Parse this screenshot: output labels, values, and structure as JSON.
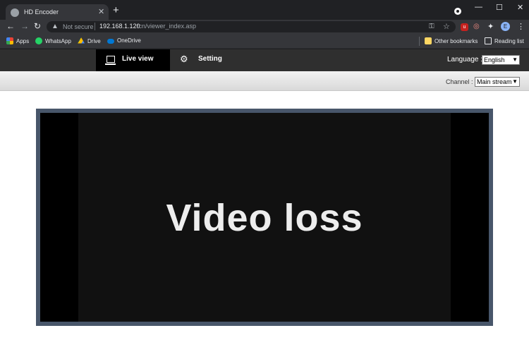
{
  "browser": {
    "tab_title": "HD Encoder",
    "tab_close": "✕",
    "new_tab": "+",
    "window_controls": {
      "minimize": "—",
      "maximize": "☐",
      "close": "✕"
    },
    "nav": {
      "back": "←",
      "forward": "→",
      "reload": "↻"
    },
    "security_label": "Not secure",
    "url_host": "192.168.1.120",
    "url_path": "/cn/viewer_index.asp",
    "avatar_initial": "E",
    "ublock_badge": "u",
    "menu": "⋮"
  },
  "bookmarks": {
    "items": [
      {
        "label": "Apps",
        "icon": "apps-grid-icon",
        "color": "#ea4335"
      },
      {
        "label": "WhatsApp",
        "icon": "whatsapp-icon",
        "color": "#25d366"
      },
      {
        "label": "Drive",
        "icon": "drive-icon",
        "color": "#fbbc04"
      },
      {
        "label": "OneDrive",
        "icon": "onedrive-icon",
        "color": "#0078d4"
      }
    ],
    "other": "Other bookmarks",
    "reading_list": "Reading list"
  },
  "header": {
    "live_view": "Live view",
    "setting": "Setting",
    "language_label": "Language :",
    "language_value": "English"
  },
  "channel": {
    "label": "Channel :",
    "value": "Main stream"
  },
  "video": {
    "status_text": "Video loss"
  }
}
